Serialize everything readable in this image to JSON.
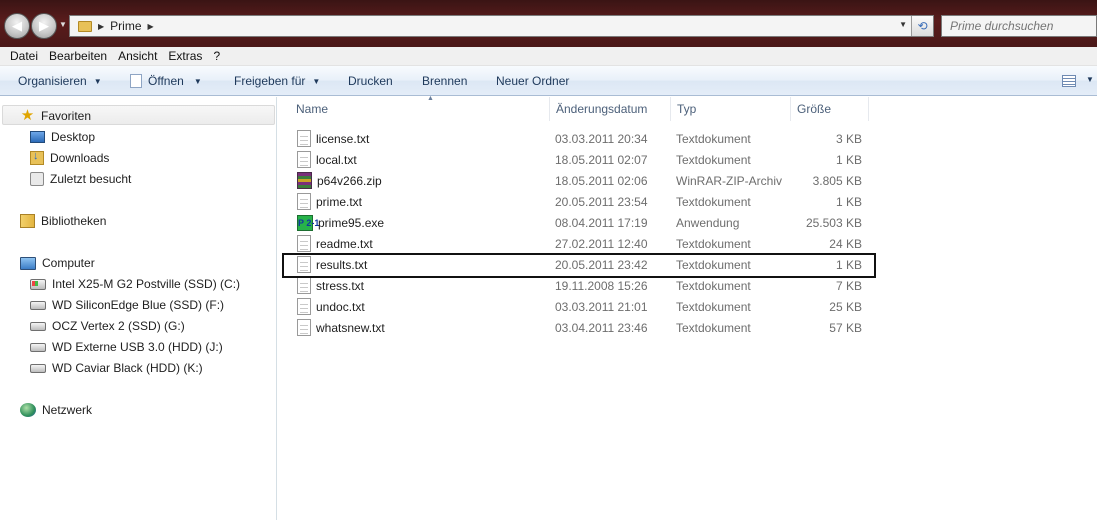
{
  "address": {
    "path": [
      "Prime"
    ],
    "search_placeholder": "Prime durchsuchen"
  },
  "menu": [
    "Datei",
    "Bearbeiten",
    "Ansicht",
    "Extras",
    "?"
  ],
  "toolbar": {
    "organize": "Organisieren",
    "open": "Öffnen",
    "share": "Freigeben für",
    "print": "Drucken",
    "burn": "Brennen",
    "new_folder": "Neuer Ordner"
  },
  "navigation": {
    "favorites": {
      "label": "Favoriten",
      "items": [
        "Desktop",
        "Downloads",
        "Zuletzt besucht"
      ]
    },
    "libraries": "Bibliotheken",
    "computer": {
      "label": "Computer",
      "drives": [
        "Intel X25-M G2 Postville (SSD) (C:)",
        "WD SiliconEdge Blue (SSD) (F:)",
        "OCZ Vertex 2 (SSD) (G:)",
        "WD Externe USB 3.0 (HDD) (J:)",
        "WD Caviar Black (HDD) (K:)"
      ]
    },
    "network": "Netzwerk"
  },
  "columns": {
    "name": "Name",
    "date": "Änderungsdatum",
    "type": "Typ",
    "size": "Größe"
  },
  "files": [
    {
      "name": "license.txt",
      "date": "03.03.2011 20:34",
      "type": "Textdokument",
      "size": "3 KB",
      "icon": "text-file-icon"
    },
    {
      "name": "local.txt",
      "date": "18.05.2011 02:07",
      "type": "Textdokument",
      "size": "1 KB",
      "icon": "text-file-icon"
    },
    {
      "name": "p64v266.zip",
      "date": "18.05.2011 02:06",
      "type": "WinRAR-ZIP-Archiv",
      "size": "3.805 KB",
      "icon": "zip-archive-icon"
    },
    {
      "name": "prime.txt",
      "date": "20.05.2011 23:54",
      "type": "Textdokument",
      "size": "1 KB",
      "icon": "text-file-icon"
    },
    {
      "name": "prime95.exe",
      "date": "08.04.2011 17:19",
      "type": "Anwendung",
      "size": "25.503 KB",
      "icon": "application-icon",
      "icon_text": "P 2-1"
    },
    {
      "name": "readme.txt",
      "date": "27.02.2011 12:40",
      "type": "Textdokument",
      "size": "24 KB",
      "icon": "text-file-icon"
    },
    {
      "name": "results.txt",
      "date": "20.05.2011 23:42",
      "type": "Textdokument",
      "size": "1 KB",
      "icon": "text-file-icon",
      "highlighted": true
    },
    {
      "name": "stress.txt",
      "date": "19.11.2008 15:26",
      "type": "Textdokument",
      "size": "7 KB",
      "icon": "text-file-icon"
    },
    {
      "name": "undoc.txt",
      "date": "03.03.2011 21:01",
      "type": "Textdokument",
      "size": "25 KB",
      "icon": "text-file-icon"
    },
    {
      "name": "whatsnew.txt",
      "date": "03.04.2011 23:46",
      "type": "Textdokument",
      "size": "57 KB",
      "icon": "text-file-icon"
    }
  ]
}
